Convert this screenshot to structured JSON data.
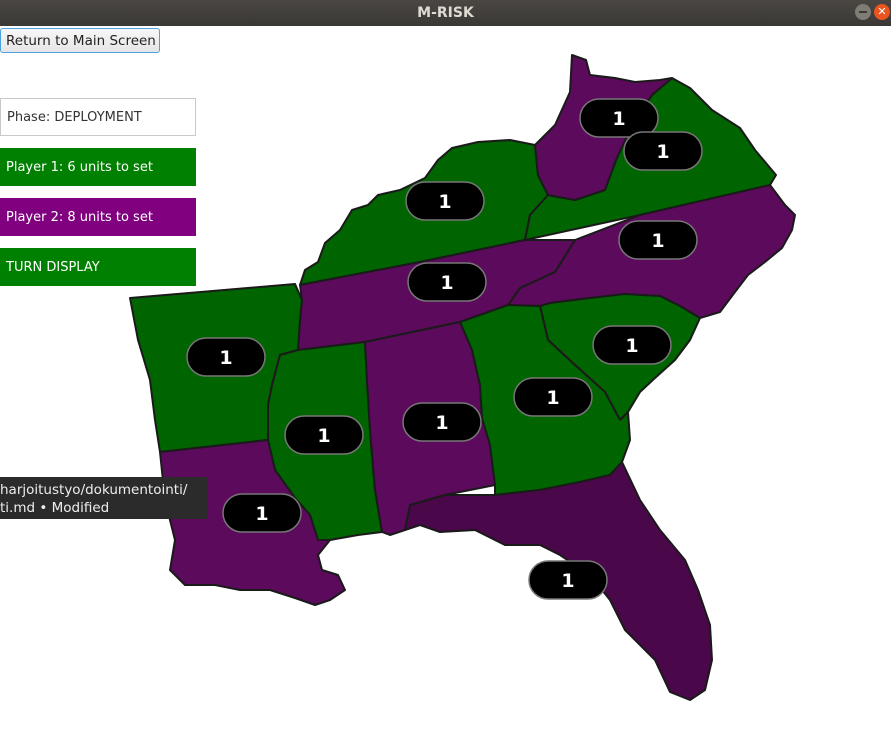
{
  "window": {
    "title": "M-RISK"
  },
  "controls": {
    "return_label": "Return to Main Screen",
    "phase_label": "Phase: DEPLOYMENT",
    "player1_label": "Player 1: 6 units to set",
    "player2_label": "Player 2: 8 units to set",
    "turn_display_label": "TURN DISPLAY"
  },
  "colors": {
    "player1": "#008000",
    "player2": "#800080",
    "territory_green": "#006400",
    "territory_purple": "#5c0a5c",
    "territory_purple_dark": "#4a0749"
  },
  "territories": [
    {
      "name": "territory-west-virginia",
      "owner": "player2",
      "units": "1"
    },
    {
      "name": "territory-virginia",
      "owner": "player1",
      "units": "1"
    },
    {
      "name": "territory-kentucky",
      "owner": "player1",
      "units": "1"
    },
    {
      "name": "territory-north-carolina",
      "owner": "player2",
      "units": "1"
    },
    {
      "name": "territory-tennessee",
      "owner": "player2",
      "units": "1"
    },
    {
      "name": "territory-arkansas",
      "owner": "player1",
      "units": "1"
    },
    {
      "name": "territory-south-carolina",
      "owner": "player1",
      "units": "1"
    },
    {
      "name": "territory-mississippi",
      "owner": "player1",
      "units": "1"
    },
    {
      "name": "territory-alabama",
      "owner": "player2",
      "units": "1"
    },
    {
      "name": "territory-georgia",
      "owner": "player1",
      "units": "1"
    },
    {
      "name": "territory-louisiana",
      "owner": "player2",
      "units": "1"
    },
    {
      "name": "territory-florida",
      "owner": "player2",
      "units": "1"
    }
  ],
  "tooltip": {
    "line1": "harjoitustyo/dokumentointi/",
    "line2": "ti.md • Modified"
  }
}
